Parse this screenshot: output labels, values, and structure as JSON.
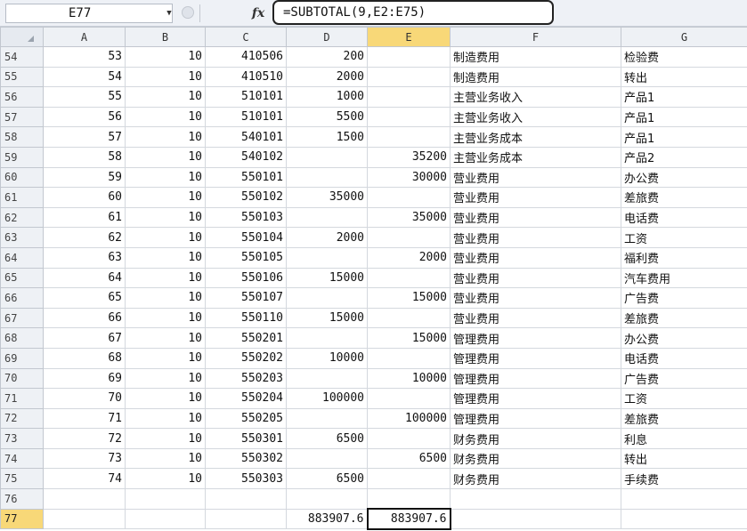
{
  "formula_bar": {
    "name_box": "E77",
    "fx_label": "fx",
    "formula": "=SUBTOTAL(9,E2:E75)"
  },
  "columns": [
    "A",
    "B",
    "C",
    "D",
    "E",
    "F",
    "G"
  ],
  "selected_column": "E",
  "selected_cell": "E77",
  "rows": [
    {
      "n": "54",
      "a": "53",
      "b": "10",
      "c": "410506",
      "d": "200",
      "e": "",
      "f": "制造费用",
      "g": "检验费"
    },
    {
      "n": "55",
      "a": "54",
      "b": "10",
      "c": "410510",
      "d": "2000",
      "e": "",
      "f": "制造费用",
      "g": "转出"
    },
    {
      "n": "56",
      "a": "55",
      "b": "10",
      "c": "510101",
      "d": "1000",
      "e": "",
      "f": "主营业务收入",
      "g": "产品1"
    },
    {
      "n": "57",
      "a": "56",
      "b": "10",
      "c": "510101",
      "d": "5500",
      "e": "",
      "f": "主营业务收入",
      "g": "产品1"
    },
    {
      "n": "58",
      "a": "57",
      "b": "10",
      "c": "540101",
      "d": "1500",
      "e": "",
      "f": "主营业务成本",
      "g": "产品1"
    },
    {
      "n": "59",
      "a": "58",
      "b": "10",
      "c": "540102",
      "d": "",
      "e": "35200",
      "f": "主营业务成本",
      "g": "产品2"
    },
    {
      "n": "60",
      "a": "59",
      "b": "10",
      "c": "550101",
      "d": "",
      "e": "30000",
      "f": "营业费用",
      "g": "办公费"
    },
    {
      "n": "61",
      "a": "60",
      "b": "10",
      "c": "550102",
      "d": "35000",
      "e": "",
      "f": "营业费用",
      "g": "差旅费"
    },
    {
      "n": "62",
      "a": "61",
      "b": "10",
      "c": "550103",
      "d": "",
      "e": "35000",
      "f": "营业费用",
      "g": "电话费"
    },
    {
      "n": "63",
      "a": "62",
      "b": "10",
      "c": "550104",
      "d": "2000",
      "e": "",
      "f": "营业费用",
      "g": "工资"
    },
    {
      "n": "64",
      "a": "63",
      "b": "10",
      "c": "550105",
      "d": "",
      "e": "2000",
      "f": "营业费用",
      "g": "福利费"
    },
    {
      "n": "65",
      "a": "64",
      "b": "10",
      "c": "550106",
      "d": "15000",
      "e": "",
      "f": "营业费用",
      "g": "汽车费用"
    },
    {
      "n": "66",
      "a": "65",
      "b": "10",
      "c": "550107",
      "d": "",
      "e": "15000",
      "f": "营业费用",
      "g": "广告费"
    },
    {
      "n": "67",
      "a": "66",
      "b": "10",
      "c": "550110",
      "d": "15000",
      "e": "",
      "f": "营业费用",
      "g": "差旅费"
    },
    {
      "n": "68",
      "a": "67",
      "b": "10",
      "c": "550201",
      "d": "",
      "e": "15000",
      "f": "管理费用",
      "g": "办公费"
    },
    {
      "n": "69",
      "a": "68",
      "b": "10",
      "c": "550202",
      "d": "10000",
      "e": "",
      "f": "管理费用",
      "g": "电话费"
    },
    {
      "n": "70",
      "a": "69",
      "b": "10",
      "c": "550203",
      "d": "",
      "e": "10000",
      "f": "管理费用",
      "g": "广告费"
    },
    {
      "n": "71",
      "a": "70",
      "b": "10",
      "c": "550204",
      "d": "100000",
      "e": "",
      "f": "管理费用",
      "g": "工资"
    },
    {
      "n": "72",
      "a": "71",
      "b": "10",
      "c": "550205",
      "d": "",
      "e": "100000",
      "f": "管理费用",
      "g": "差旅费"
    },
    {
      "n": "73",
      "a": "72",
      "b": "10",
      "c": "550301",
      "d": "6500",
      "e": "",
      "f": "财务费用",
      "g": "利息"
    },
    {
      "n": "74",
      "a": "73",
      "b": "10",
      "c": "550302",
      "d": "",
      "e": "6500",
      "f": "财务费用",
      "g": "转出"
    },
    {
      "n": "75",
      "a": "74",
      "b": "10",
      "c": "550303",
      "d": "6500",
      "e": "",
      "f": "财务费用",
      "g": "手续费"
    },
    {
      "n": "76",
      "a": "",
      "b": "",
      "c": "",
      "d": "",
      "e": "",
      "f": "",
      "g": ""
    },
    {
      "n": "77",
      "a": "",
      "b": "",
      "c": "",
      "d": "883907.6",
      "e": "883907.6",
      "f": "",
      "g": ""
    }
  ]
}
